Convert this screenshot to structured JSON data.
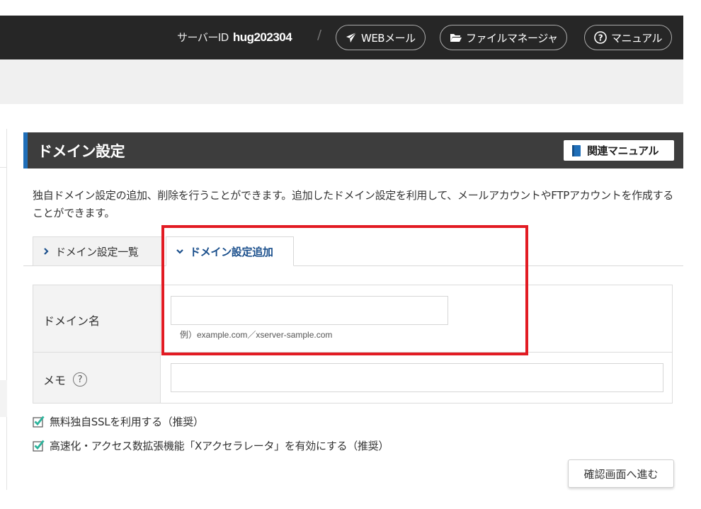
{
  "header": {
    "server_id_label": "サーバーID",
    "server_id_value": "hug202304",
    "separator": "/",
    "buttons": [
      {
        "label": "WEBメール",
        "icon": "paper-plane-icon"
      },
      {
        "label": "ファイルマネージャ",
        "icon": "folder-icon"
      },
      {
        "label": "マニュアル",
        "icon": "question-circle-icon"
      }
    ]
  },
  "section": {
    "title": "ドメイン設定",
    "manual_button": "関連マニュアル",
    "description": "独自ドメイン設定の追加、削除を行うことができます。追加したドメイン設定を利用して、メールアカウントやFTPアカウントを作成することができます。"
  },
  "tabs": [
    {
      "label": "ドメイン設定一覧",
      "icon": "chevron-right-icon",
      "active": false
    },
    {
      "label": "ドメイン設定追加",
      "icon": "chevron-down-icon",
      "active": true
    }
  ],
  "form": {
    "domain_label": "ドメイン名",
    "domain_value": "",
    "domain_example": "例）example.com／xserver-sample.com",
    "memo_label": "メモ",
    "memo_help": "?",
    "memo_value": ""
  },
  "options": [
    {
      "label": "無料独自SSLを利用する（推奨）",
      "checked": true
    },
    {
      "label": "高速化・アクセス数拡張機能「Xアクセラレータ」を有効にする（推奨）",
      "checked": true
    }
  ],
  "submit_label": "確認画面へ進む",
  "colors": {
    "header_bg": "#262626",
    "accent_blue": "#1f6eb8",
    "tab_active_text": "#1a4f8c",
    "check_green": "#2bb39b",
    "highlight_red": "#e21b23"
  }
}
